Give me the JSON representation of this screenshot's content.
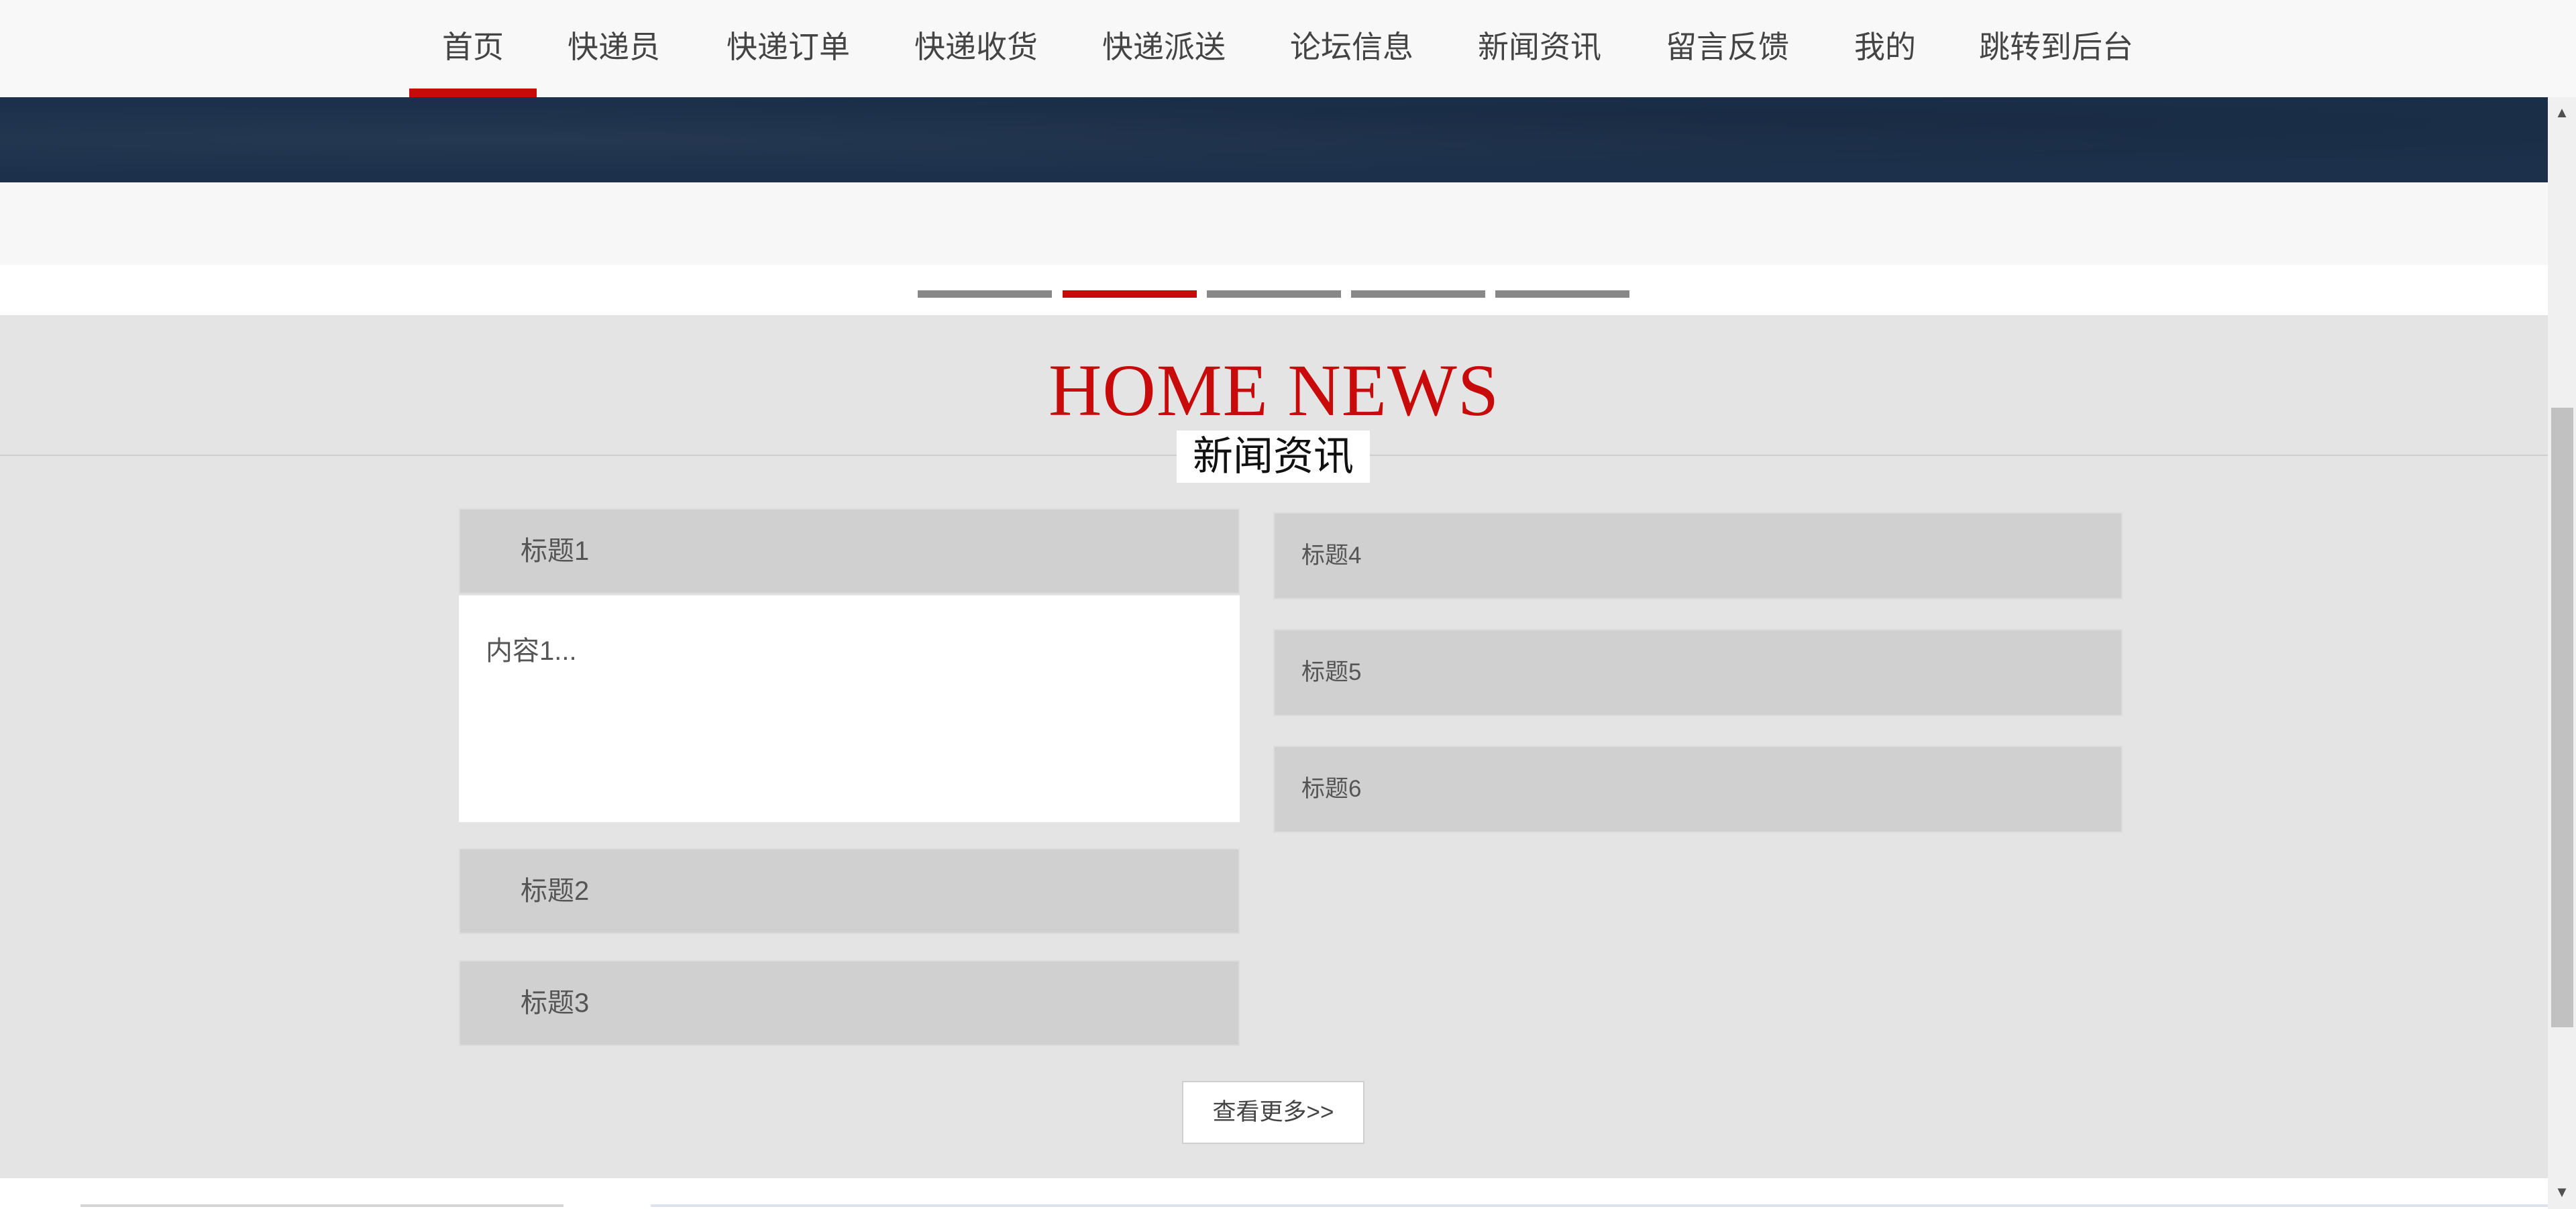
{
  "nav": {
    "items": [
      {
        "label": "首页",
        "active": true
      },
      {
        "label": "快递员"
      },
      {
        "label": "快递订单"
      },
      {
        "label": "快递收货"
      },
      {
        "label": "快递派送"
      },
      {
        "label": "论坛信息"
      },
      {
        "label": "新闻资讯"
      },
      {
        "label": "留言反馈"
      },
      {
        "label": "我的"
      },
      {
        "label": "跳转到后台"
      }
    ]
  },
  "carousel": {
    "slide_count": 5,
    "active_index": 1
  },
  "news": {
    "title_en": "HOME NEWS",
    "title_cn": "新闻资讯",
    "left_items": [
      {
        "title": "标题1",
        "expanded": true,
        "content": "内容1..."
      },
      {
        "title": "标题2"
      },
      {
        "title": "标题3"
      }
    ],
    "right_items": [
      {
        "title": "标题4"
      },
      {
        "title": "标题5"
      },
      {
        "title": "标题6"
      }
    ],
    "more_label": "查看更多>>"
  },
  "colors": {
    "accent": "#c80a0a",
    "banner": "#1c304b",
    "section_bg": "#e4e4e4",
    "item_bg": "#d0d0d0"
  },
  "icons": {
    "scroll_up": "▲",
    "scroll_down": "▼"
  }
}
